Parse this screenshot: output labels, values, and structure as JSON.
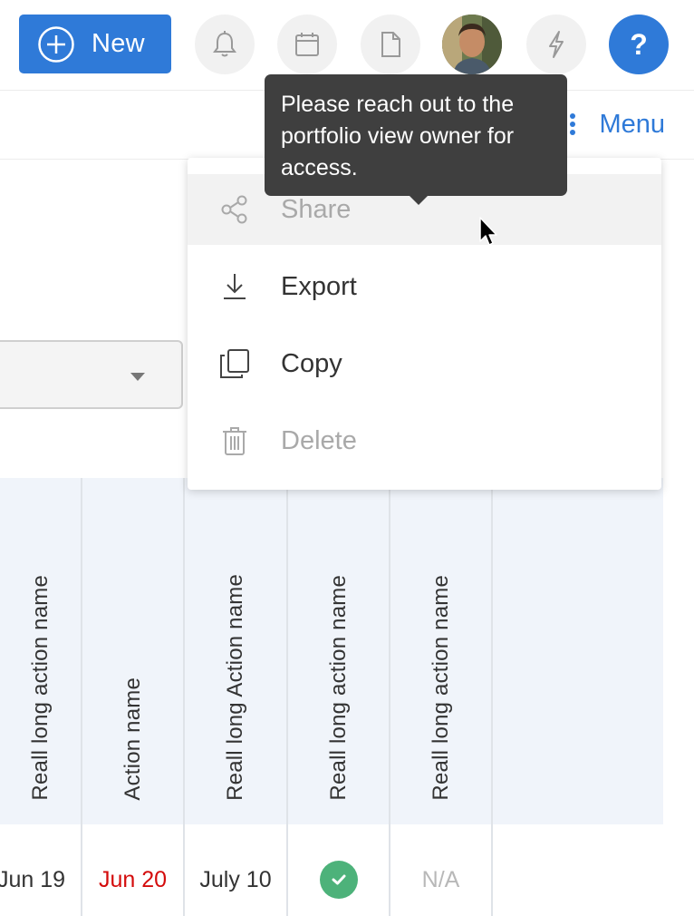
{
  "toolbar": {
    "new_label": "New",
    "icons": [
      "bell-icon",
      "calendar-icon",
      "document-icon",
      "lightning-icon"
    ],
    "help_label": "?",
    "accent_color": "#2f7ad8"
  },
  "subbar": {
    "menu_label": "Menu"
  },
  "tooltip": {
    "text": "Please reach out to the portfolio view owner for access."
  },
  "dropdown": {
    "items": [
      {
        "label": "Share",
        "icon": "share-icon",
        "enabled": false
      },
      {
        "label": "Export",
        "icon": "download-icon",
        "enabled": true
      },
      {
        "label": "Copy",
        "icon": "copy-icon",
        "enabled": true
      },
      {
        "label": "Delete",
        "icon": "trash-icon",
        "enabled": false
      }
    ]
  },
  "table": {
    "headers": [
      "Reall long action name",
      "Action name",
      "Reall long Action name",
      "Reall long action name",
      "Reall long action name"
    ],
    "row": [
      "Jun 19",
      "Jun 20",
      "July 10",
      "",
      "N/A"
    ],
    "status_colors": {
      "late": "#d40c0c",
      "done": "#4db27a",
      "na": "#b8b8b8"
    }
  }
}
